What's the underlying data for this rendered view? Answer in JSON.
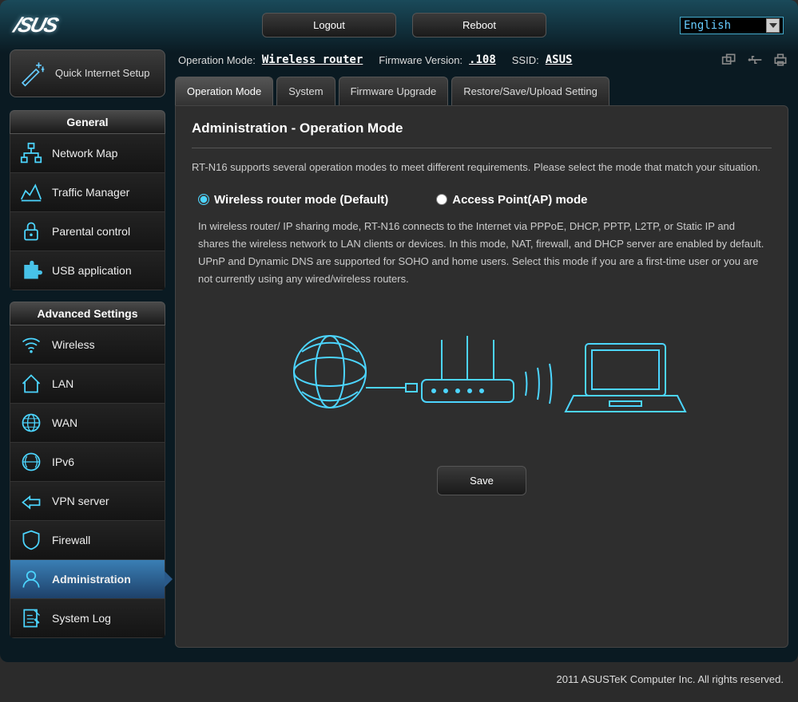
{
  "brand": "/SUS",
  "top": {
    "logout": "Logout",
    "reboot": "Reboot",
    "language": "English"
  },
  "info": {
    "op_mode_label": "Operation Mode:",
    "op_mode_value": "Wireless router",
    "fw_label": "Firmware Version:",
    "fw_value": ".108",
    "ssid_label": "SSID:",
    "ssid_value": "ASUS"
  },
  "qis": "Quick Internet Setup",
  "sections": {
    "general": "General",
    "advanced": "Advanced Settings"
  },
  "general_menu": [
    {
      "label": "Network Map"
    },
    {
      "label": "Traffic Manager"
    },
    {
      "label": "Parental control"
    },
    {
      "label": "USB application"
    }
  ],
  "advanced_menu": [
    {
      "label": "Wireless"
    },
    {
      "label": "LAN"
    },
    {
      "label": "WAN"
    },
    {
      "label": "IPv6"
    },
    {
      "label": "VPN server"
    },
    {
      "label": "Firewall"
    },
    {
      "label": "Administration"
    },
    {
      "label": "System Log"
    }
  ],
  "tabs": [
    "Operation Mode",
    "System",
    "Firmware Upgrade",
    "Restore/Save/Upload Setting"
  ],
  "panel": {
    "title": "Administration - Operation Mode",
    "intro": "RT-N16 supports several operation modes to meet different requirements. Please select the mode that match your situation.",
    "radio1": "Wireless router mode (Default)",
    "radio2": "Access Point(AP) mode",
    "mode_desc": "In wireless router/ IP sharing mode, RT-N16 connects to the Internet via PPPoE, DHCP, PPTP, L2TP, or Static IP and shares the wireless network to LAN clients or devices. In this mode, NAT, firewall, and DHCP server are enabled by default. UPnP and Dynamic DNS are supported for SOHO and home users. Select this mode if you are a first-time user or you are not currently using any wired/wireless routers.",
    "save": "Save"
  },
  "footer": "2011 ASUSTeK Computer Inc. All rights reserved."
}
